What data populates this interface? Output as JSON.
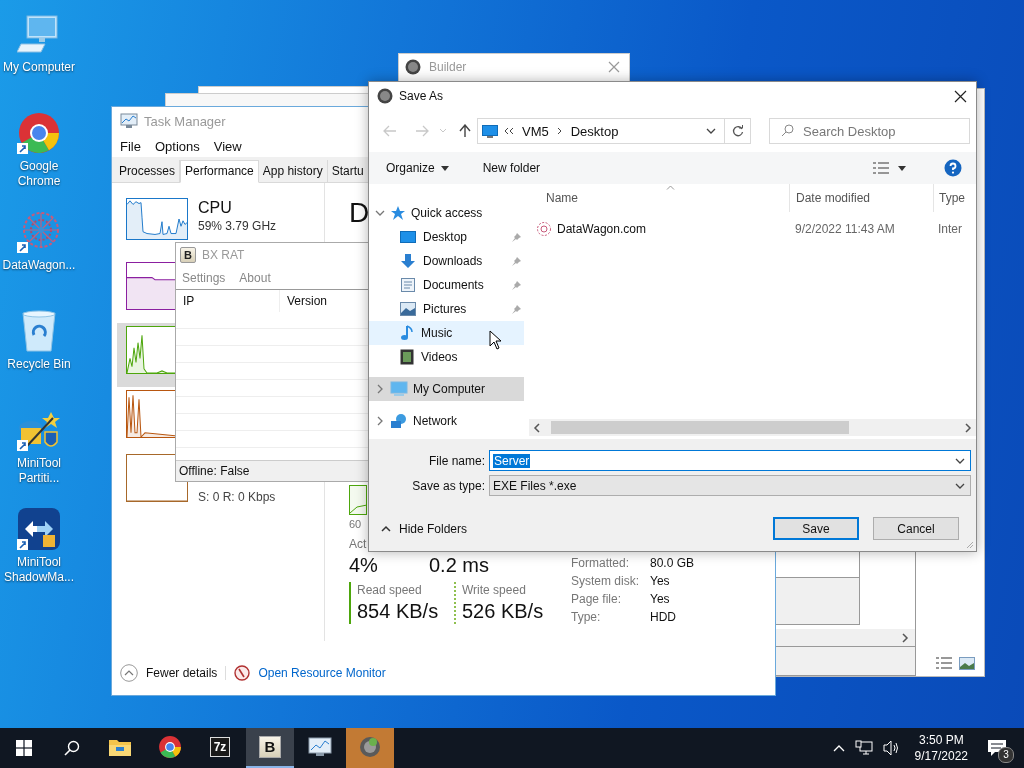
{
  "desktop_icons": [
    {
      "label": "My Computer",
      "kind": "computer",
      "shortcut": false
    },
    {
      "label": "Google Chrome",
      "kind": "browser",
      "shortcut": true
    },
    {
      "label": "DataWagon...",
      "kind": "pattern",
      "shortcut": true
    },
    {
      "label": "Recycle Bin",
      "kind": "recycle",
      "shortcut": false
    },
    {
      "label": "MiniTool Partiti...",
      "kind": "wand",
      "shortcut": true
    },
    {
      "label": "MiniTool ShadowMa...",
      "kind": "arrows",
      "shortcut": true
    }
  ],
  "builder": {
    "title": "Builder"
  },
  "task_manager": {
    "title": "Task Manager",
    "menu": [
      "File",
      "Options",
      "View"
    ],
    "tabs": [
      {
        "label": "Processes",
        "selected": false
      },
      {
        "label": "Performance",
        "selected": true
      },
      {
        "label": "App history",
        "selected": false
      },
      {
        "label": "Startu",
        "selected": false
      }
    ],
    "resources": [
      {
        "kind": "cpu",
        "name": "CPU",
        "detail": "59% 3.79 GHz",
        "color": "#1a77c9",
        "selected": false
      },
      {
        "kind": "memory",
        "color": "#8b1fa0",
        "selected": false
      },
      {
        "kind": "disk",
        "color": "#4da60c",
        "selected": true
      },
      {
        "kind": "disk",
        "color": "#b8560f",
        "selected": false
      },
      {
        "kind": "ethernet",
        "detail": "S: 0 R: 0 Kbps",
        "color": "#a7682a",
        "selected": false
      }
    ],
    "heading": "D",
    "graph_time": "60",
    "active_label": "Act",
    "active_value": "4%",
    "response_value": "0.2 ms",
    "read_speed": {
      "label": "Read speed",
      "value": "854 KB/s"
    },
    "write_speed": {
      "label": "Write speed",
      "value": "526 KB/s"
    },
    "properties": [
      {
        "label": "Formatted:",
        "value": "80.0 GB"
      },
      {
        "label": "System disk:",
        "value": "Yes"
      },
      {
        "label": "Page file:",
        "value": "Yes"
      },
      {
        "label": "Type:",
        "value": "HDD"
      }
    ],
    "fewer_details": "Fewer details",
    "resource_monitor": "Open Resource Monitor"
  },
  "bx_rat": {
    "icon_letter": "B",
    "title": "BX RAT",
    "menu": [
      "Settings",
      "About"
    ],
    "columns": [
      "IP",
      "Version"
    ],
    "status": "Offline: False"
  },
  "save_as": {
    "title": "Save As",
    "path": [
      "VM5",
      "Desktop"
    ],
    "search_placeholder": "Search Desktop",
    "toolbar": {
      "organize": "Organize",
      "new_folder": "New folder"
    },
    "folders": [
      {
        "label": "Quick access",
        "kind": "star",
        "expanded": true,
        "selected": false,
        "hovered": false,
        "children": [
          {
            "label": "Desktop",
            "kind": "desktop",
            "pinned": true,
            "selected": false,
            "hovered": false
          },
          {
            "label": "Downloads",
            "kind": "download",
            "pinned": true,
            "selected": false,
            "hovered": false
          },
          {
            "label": "Documents",
            "kind": "document",
            "pinned": true,
            "selected": false,
            "hovered": false
          },
          {
            "label": "Pictures",
            "kind": "picture",
            "pinned": true,
            "selected": false,
            "hovered": false
          },
          {
            "label": "Music",
            "kind": "music",
            "pinned": false,
            "selected": false,
            "hovered": true
          },
          {
            "label": "Videos",
            "kind": "video",
            "pinned": false,
            "selected": false,
            "hovered": false
          }
        ]
      },
      {
        "label": "My Computer",
        "kind": "computer",
        "expanded": false,
        "selected": true,
        "hovered": false
      },
      {
        "label": "Network",
        "kind": "network",
        "expanded": false,
        "selected": false,
        "hovered": false
      }
    ],
    "columns": [
      "Name",
      "Date modified",
      "Type"
    ],
    "files": [
      {
        "name": "DataWagon.com",
        "date": "9/2/2022 11:43 AM",
        "type": "Inter"
      }
    ],
    "file_name_label": "File name:",
    "file_name": {
      "value": "Server",
      "highlighted": true
    },
    "type_label": "Save as type:",
    "type_value": "EXE Files *.exe",
    "hide_folders": "Hide Folders",
    "save": "Save",
    "cancel": "Cancel"
  },
  "taskbar": {
    "apps": [
      {
        "kind": "folder",
        "active": false,
        "flashing": false
      },
      {
        "kind": "browser",
        "active": false,
        "flashing": false
      },
      {
        "kind": "archiver",
        "label": "7z",
        "active": false,
        "flashing": false
      },
      {
        "kind": "rat",
        "label": "B",
        "active": true,
        "flashing": false
      },
      {
        "kind": "monitor",
        "active": false,
        "flashing": false
      },
      {
        "kind": "builder",
        "active": false,
        "flashing": true
      }
    ],
    "time": "3:50 PM",
    "date": "9/17/2022",
    "notifications": "3"
  }
}
